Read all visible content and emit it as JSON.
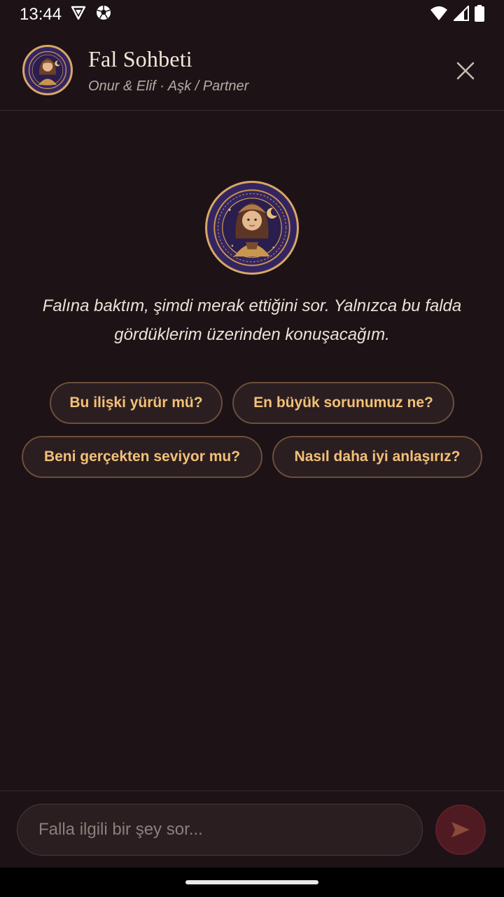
{
  "status_bar": {
    "time": "13:44",
    "icons": [
      "vpn-shield-icon",
      "soccer-ball-icon",
      "wifi-icon",
      "signal-icon",
      "battery-icon"
    ]
  },
  "header": {
    "title": "Fal Sohbeti",
    "subtitle": "Onur & Elif · Aşk / Partner",
    "avatar": "fortune-teller-avatar",
    "close_icon": "close-icon"
  },
  "chat": {
    "intro": "Falına baktım, şimdi merak ettiğini sor. Yalnızca bu falda gördüklerim üzerinden konuşacağım.",
    "suggestions": [
      {
        "label": "Bu ilişki yürür mü?"
      },
      {
        "label": "En büyük sorunumuz ne?"
      },
      {
        "label": "Beni gerçekten seviyor mu?"
      },
      {
        "label": "Nasıl daha iyi anlaşırız?"
      }
    ]
  },
  "composer": {
    "placeholder": "Falla ilgili bir şey sor...",
    "value": "",
    "send_icon": "send-icon"
  },
  "colors": {
    "background": "#1d1216",
    "accent_gold": "#d6a766",
    "chip_text": "#f2c177",
    "send_button": "#501a22"
  }
}
